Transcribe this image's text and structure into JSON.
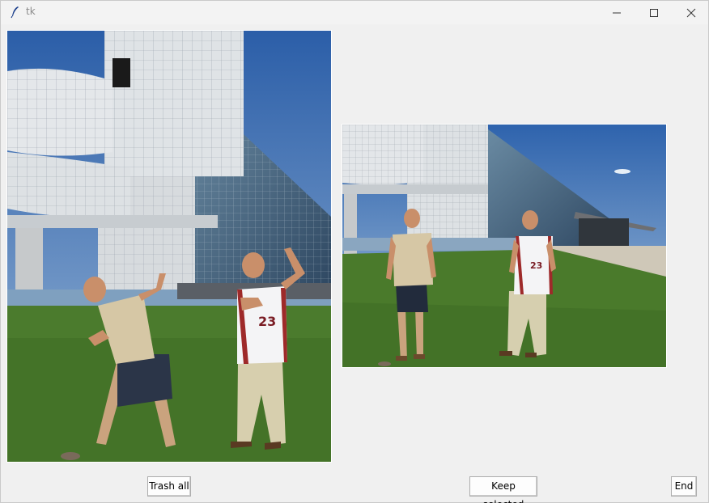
{
  "window": {
    "title": "tk",
    "controls": {
      "minimize_icon": "minimize-icon",
      "maximize_icon": "maximize-icon",
      "close_icon": "close-icon"
    }
  },
  "images": [
    {
      "name": "photo-left",
      "description_icon": "photo"
    },
    {
      "name": "photo-right",
      "description_icon": "photo"
    }
  ],
  "buttons": {
    "trash_all": "Trash all",
    "keep_selected": "Keep selected",
    "end": "End"
  },
  "jersey_number": "23"
}
